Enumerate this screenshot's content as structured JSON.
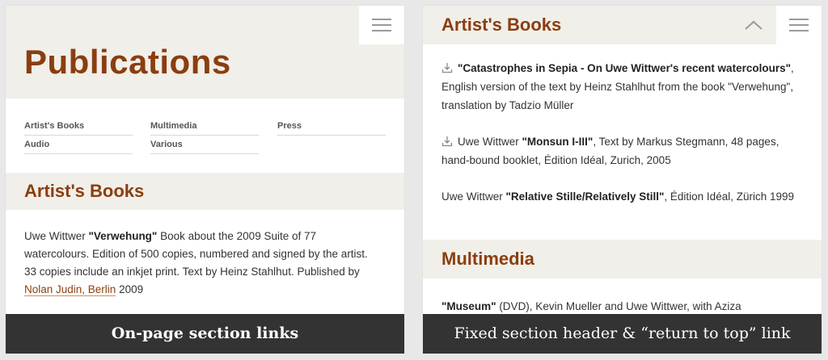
{
  "left": {
    "page_title": "Publications",
    "section_links": [
      "Artist's Books",
      "Multimedia",
      "Press",
      "Audio",
      "Various"
    ],
    "section_title": "Artist's Books",
    "entry": {
      "lead": "Uwe Wittwer ",
      "bold": "\"Verwehung\"",
      "text": " Book about the 2009 Suite of 77 watercolours. Edition of 500 copies, numbered and signed by the artist. 33 copies include an inkjet print. Text by Heinz Stahlhut. Published by ",
      "link": "Nolan Judin, Berlin",
      "tail": " 2009"
    },
    "caption": "On-page section links"
  },
  "right": {
    "section_title": "Artist's Books",
    "entries": [
      {
        "lead": "",
        "bold": "\"Catastrophes in Sepia - On Uwe Wittwer's recent watercolours\"",
        "text": ", English version of the text by Heinz Stahlhut from the book \"Verwehung\", translation by Tadzio Müller"
      },
      {
        "lead": "Uwe Wittwer ",
        "bold": "\"Monsun I-III\"",
        "text": ", Text by Markus Stegmann, 48 pages, hand-bound booklet, Édition Idéal, Zurich, 2005"
      },
      {
        "lead": "Uwe Wittwer ",
        "bold": "\"Relative Stille/Relatively Still\"",
        "text": ", Édition Idéal, Zürich 1999"
      }
    ],
    "section2_title": "Multimedia",
    "entry2": {
      "bold": "\"Museum\"",
      "text": " (DVD), Kevin Mueller and Uwe Wittwer, with Aziza"
    },
    "caption": "Fixed section header & “return to top” link"
  },
  "icons": [
    "menu-icon",
    "chevron-up-icon",
    "download-icon"
  ],
  "colors": {
    "accent": "#8a3e10",
    "header_bg": "#f1efe9",
    "caption_bg": "#333333"
  }
}
